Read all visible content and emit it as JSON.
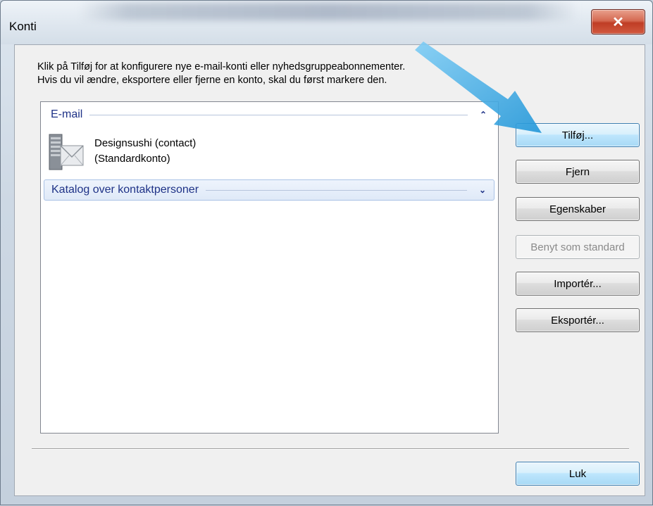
{
  "window": {
    "title": "Konti",
    "close_glyph": "✕"
  },
  "instructions": {
    "line1": "Klik på Tilføj for at konfigurere nye e-mail-konti eller nyhedsgruppeabonnementer.",
    "line2": "Hvis du vil ændre, eksportere eller fjerne en konto, skal du først markere den."
  },
  "list": {
    "groups": [
      {
        "label": "E-mail",
        "chevron_icon": "chevron-up-icon",
        "chevron": "⌃"
      },
      {
        "label": "Katalog over kontaktpersoner",
        "chevron_icon": "chevron-down-icon",
        "chevron": "⌄"
      }
    ],
    "accounts": [
      {
        "name": "Designsushi (contact)",
        "subtitle": "(Standardkonto)",
        "icon": "mail-server-icon"
      }
    ]
  },
  "buttons": {
    "add": "Tilføj...",
    "remove": "Fjern",
    "properties": "Egenskaber",
    "set_default": "Benyt som standard",
    "import": "Importér...",
    "export": "Eksportér...",
    "close": "Luk"
  },
  "colors": {
    "group_header_text": "#1e3287",
    "arrow": "#3aa6e0",
    "close_button": "#c8472f"
  }
}
